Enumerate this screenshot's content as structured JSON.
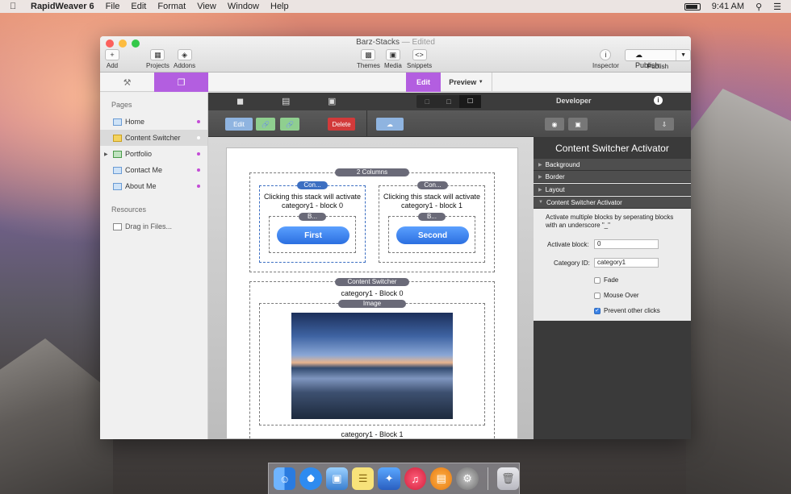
{
  "menubar": {
    "apple": "",
    "app_name": "RapidWeaver 6",
    "menus": [
      "File",
      "Edit",
      "Format",
      "View",
      "Window",
      "Help"
    ],
    "time": "9:41 AM"
  },
  "window": {
    "title": "Barz-Stacks",
    "title_sep": " — ",
    "edited": "Edited"
  },
  "toolbar": {
    "add": "Add",
    "projects": "Projects",
    "addons": "Addons",
    "themes": "Themes",
    "media": "Media",
    "snippets": "Snippets",
    "inspector": "Inspector",
    "publish_button": "Publish",
    "publish_label": "Publish"
  },
  "modes": {
    "edit": "Edit",
    "preview": "Preview"
  },
  "sidebar": {
    "pages_header": "Pages",
    "pages": [
      {
        "label": "Home"
      },
      {
        "label": "Content Switcher"
      },
      {
        "label": "Portfolio"
      },
      {
        "label": "Contact Me"
      },
      {
        "label": "About Me"
      }
    ],
    "resources_header": "Resources",
    "drag_files": "Drag in Files..."
  },
  "stacks_toolbar": {
    "edit": "Edit",
    "delete": "Delete"
  },
  "canvas": {
    "two_columns": "2 Columns",
    "col1_pill": "Con...",
    "col2_pill": "Con...",
    "col1_text": "Clicking this stack will activate category1 - block 0",
    "col2_text": "Clicking this stack will activate category1 - block 1",
    "b_pill_1": "B...",
    "b_pill_2": "B...",
    "first_button": "First",
    "second_button": "Second",
    "content_switcher_pill": "Content Switcher",
    "block0_label": "category1 - Block 0",
    "image_pill": "Image",
    "block1_label": "category1 - Block 1"
  },
  "inspector": {
    "developer": "Developer",
    "title": "Content Switcher Activator",
    "sections": [
      "Background",
      "Border",
      "Layout",
      "Content Switcher Activator"
    ],
    "description": "Activate multiple blocks by seperating blocks with an underscore \"_\"",
    "activate_block_label": "Activate block:",
    "activate_block_value": "0",
    "category_id_label": "Category ID:",
    "category_id_value": "category1",
    "fade_label": "Fade",
    "mouse_over_label": "Mouse Over",
    "prevent_label": "Prevent other clicks",
    "checkbox_states": {
      "fade": false,
      "mouse_over": false,
      "prevent": true
    }
  },
  "colors": {
    "accent": "#b35ee0",
    "delete": "#d23a3a",
    "link_green": "#5aa35a",
    "button_blue": "#3b82f6"
  },
  "dock": {
    "icons": [
      "finder-icon",
      "safari-icon",
      "preview-icon",
      "notes-icon",
      "rapidweaver-icon",
      "itunes-icon",
      "ibooks-icon",
      "system-preferences-icon",
      "trash-icon"
    ]
  }
}
